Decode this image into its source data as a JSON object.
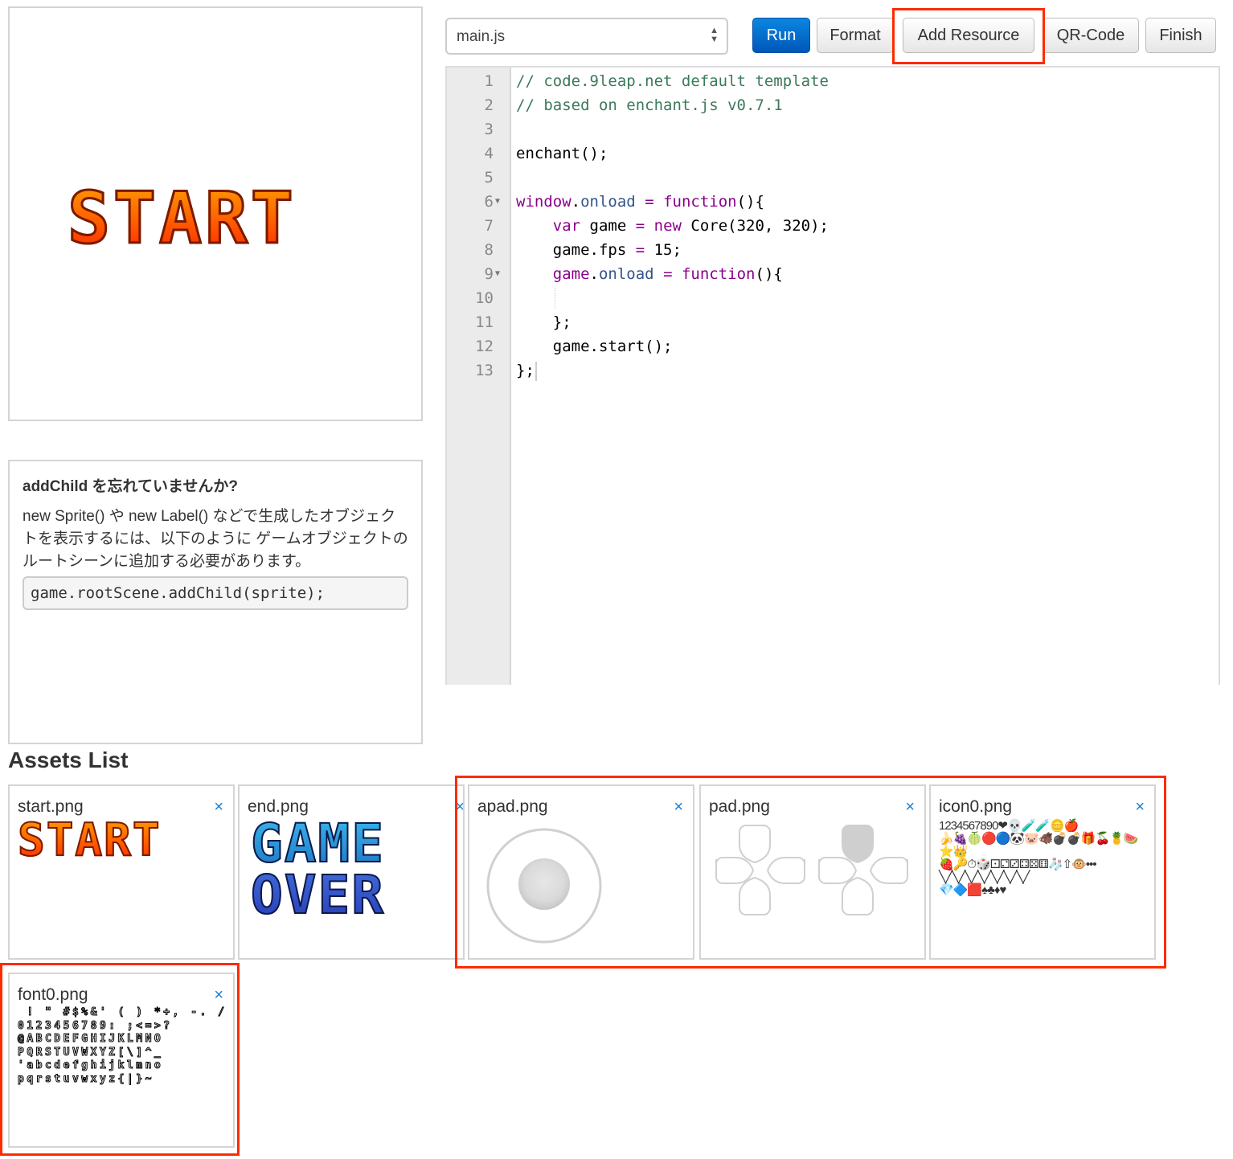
{
  "preview": {
    "title_art_text": "START"
  },
  "hint": {
    "title": "addChild を忘れていませんか?",
    "body": "new Sprite() や new Label() などで生成したオブジェクトを表示するには、以下のように ゲームオブジェクトのルートシーンに追加する必要があります。",
    "code": "game.rootScene.addChild(sprite);"
  },
  "toolbar": {
    "file_select": {
      "value": "main.js",
      "icon": "updown-arrows-icon"
    },
    "buttons": {
      "run": "Run",
      "format": "Format",
      "add_resource": "Add Resource",
      "qr_code": "QR-Code",
      "finish": "Finish"
    },
    "accent_color": "#0069d0"
  },
  "editor": {
    "lines": [
      {
        "n": "1",
        "text": "// code.9leap.net default template"
      },
      {
        "n": "2",
        "text": "// based on enchant.js v0.7.1"
      },
      {
        "n": "3",
        "text": ""
      },
      {
        "n": "4",
        "text": "enchant();"
      },
      {
        "n": "5",
        "text": ""
      },
      {
        "n": "6",
        "text": "window.onload = function(){",
        "foldable": true
      },
      {
        "n": "7",
        "text": "    var game = new Core(320, 320);"
      },
      {
        "n": "8",
        "text": "    game.fps = 15;"
      },
      {
        "n": "9",
        "text": "    game.onload = function(){",
        "foldable": true
      },
      {
        "n": "10",
        "text": ""
      },
      {
        "n": "11",
        "text": "    };"
      },
      {
        "n": "12",
        "text": "    game.start();"
      },
      {
        "n": "13",
        "text": "};"
      }
    ]
  },
  "assets": {
    "title": "Assets List",
    "close_label": "×",
    "items": [
      {
        "name": "start.png",
        "preview_text": "START"
      },
      {
        "name": "end.png",
        "preview_line1": "GAME",
        "preview_line2": "OVER"
      },
      {
        "name": "apad.png"
      },
      {
        "name": "pad.png"
      },
      {
        "name": "icon0.png",
        "preview_text": "1234567890❤💀🧪🧪🪙🍎\n🍌🍇🍈🔴🔵🐼🐷🐗💣💣🎁🍒🍍🍉⭐👑\n🍓🔑⏱🎲⚀⚁⚂⚃⚄⚅🧦⇧🐵•••\n╲╱╲╱╲╱╲╱╲╱╲╱╲╱\n💎🔷🟥♠♣♦♥"
      },
      {
        "name": "font0.png",
        "preview_text": " ! \" #$%&' ( ) *+, -. /\n0123456789: ;<=>?\n@ABCDEFGHIJKLMNO\nPQRSTUVWXYZ[\\]^_\n'abcdefghijklmno\npqrstuvwxyz{|}~"
      }
    ]
  }
}
